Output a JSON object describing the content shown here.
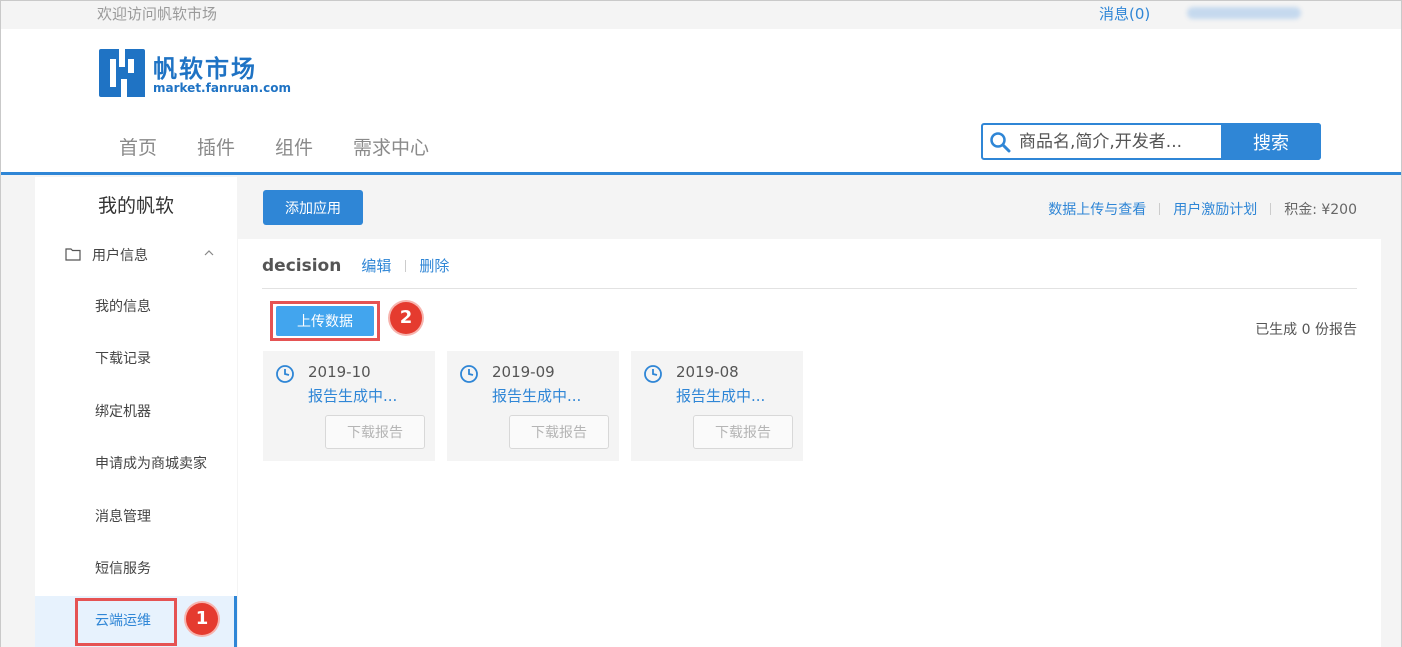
{
  "topbar": {
    "welcome": "欢迎访问帆软市场",
    "messages": "消息(0)"
  },
  "logo": {
    "title": "帆软市场",
    "subtitle": "market.fanruan.com"
  },
  "nav": {
    "items": [
      "首页",
      "插件",
      "组件",
      "需求中心"
    ]
  },
  "search": {
    "placeholder": "商品名,简介,开发者...",
    "button": "搜索"
  },
  "sidebar": {
    "title": "我的帆软",
    "group_label": "用户信息",
    "items": [
      "我的信息",
      "下载记录",
      "绑定机器",
      "申请成为商城卖家",
      "消息管理",
      "短信服务",
      "云端运维"
    ],
    "active_item": "云端运维"
  },
  "main": {
    "add_button": "添加应用",
    "links": [
      "数据上传与查看",
      "用户激励计划"
    ],
    "points": "积金: ¥200",
    "app_name": "decision",
    "edit": "编辑",
    "delete": "删除",
    "upload_button": "上传数据",
    "generated_count": "已生成 0 份报告",
    "cards": [
      {
        "date": "2019-10",
        "status": "报告生成中...",
        "button": "下载报告"
      },
      {
        "date": "2019-09",
        "status": "报告生成中...",
        "button": "下载报告"
      },
      {
        "date": "2019-08",
        "status": "报告生成中...",
        "button": "下载报告"
      }
    ]
  },
  "annotations": {
    "badge_1": "1",
    "badge_2": "2"
  },
  "colors": {
    "primary": "#2f86d6",
    "highlight": "#e55353",
    "badge": "#e53b2f"
  }
}
